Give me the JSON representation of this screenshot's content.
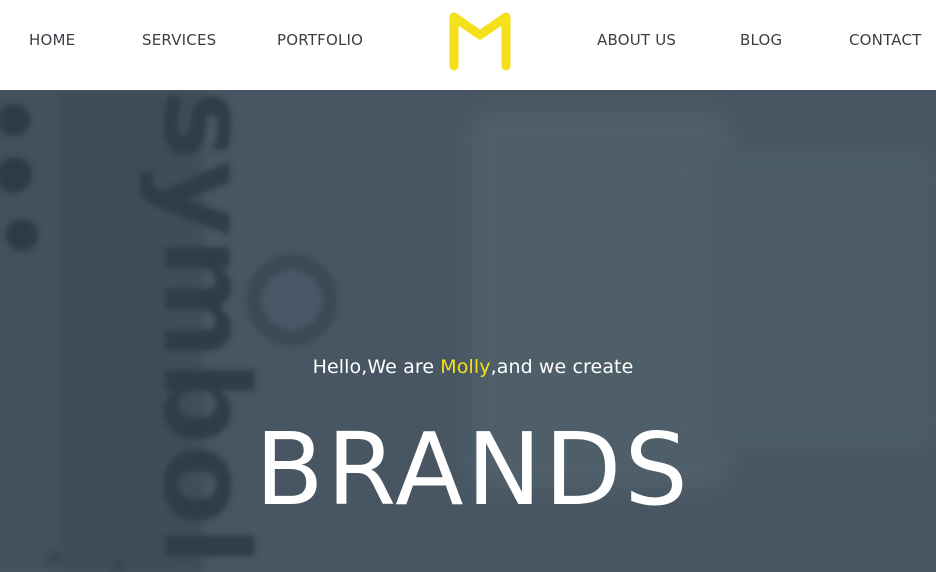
{
  "nav": {
    "left_items": [
      {
        "label": "HOME"
      },
      {
        "label": "SERVICES"
      },
      {
        "label": "PORTFOLIO"
      }
    ],
    "right_items": [
      {
        "label": "ABOUT US"
      },
      {
        "label": "BLOG"
      },
      {
        "label": "CONTACT"
      }
    ],
    "logo_icon": "m-logo-icon"
  },
  "hero": {
    "tagline_before": "Hello,We are ",
    "tagline_brand": "Molly",
    "tagline_after": ",and we create",
    "title": "BRANDS",
    "background_image": "symbol-book-photo",
    "background_image_text": "symbol"
  },
  "colors": {
    "accent": "#f5e11b",
    "hero_overlay": "#475662",
    "nav_text": "#3a3f45",
    "nav_background": "#ffffff"
  }
}
